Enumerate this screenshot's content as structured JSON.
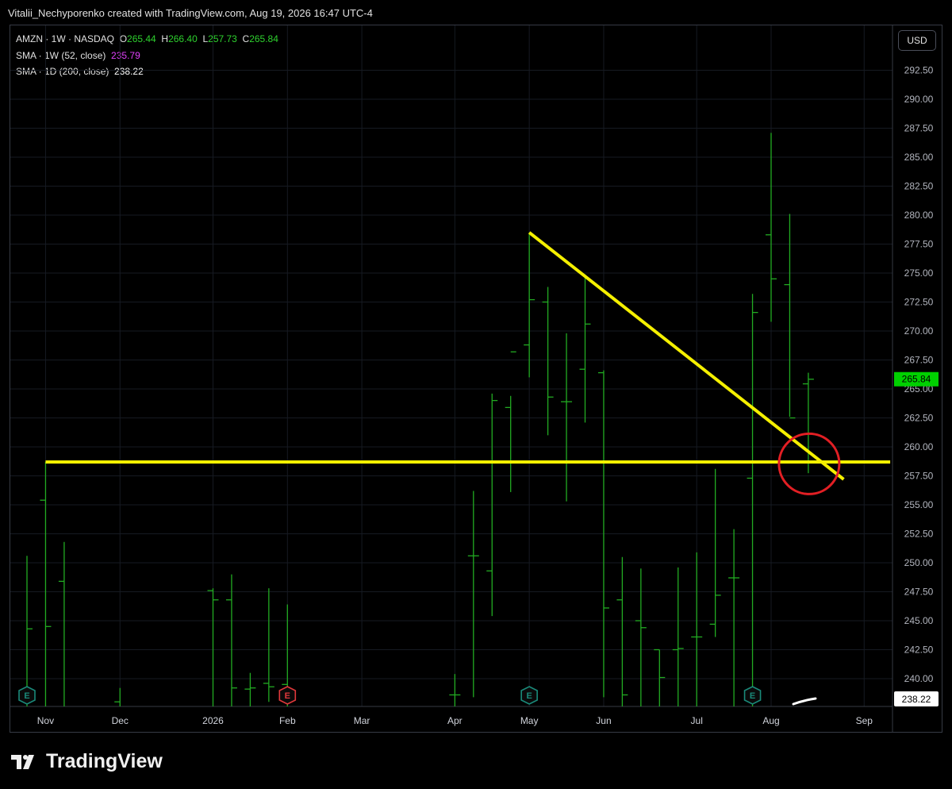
{
  "header": {
    "attribution": "Vitalii_Nechyporenko created with TradingView.com, Aug 19, 2026 16:47 UTC-4"
  },
  "legend": {
    "symbol": "AMZN · 1W · NASDAQ",
    "open_label": "O",
    "open": "265.44",
    "high_label": "H",
    "high": "266.40",
    "low_label": "L",
    "low": "257.73",
    "close_label": "C",
    "close": "265.84",
    "sma1_label": "SMA · 1W (52, close)",
    "sma1_value": "235.79",
    "sma2_label": "SMA · 1D (200, close)",
    "sma2_value": "238.22"
  },
  "currency_button": "USD",
  "brand": "TradingView",
  "colors": {
    "bar": "#22ab22",
    "drawing": "#f5f000",
    "circle": "#e21f24",
    "last_price_bg": "#00d000",
    "sma1": "#e040fb",
    "earnings_green": "#1a8a7a",
    "earnings_red": "#e0383b"
  },
  "chart_data": {
    "type": "ohlc",
    "interval": "1W",
    "ylim": [
      238.5,
      294
    ],
    "y_ticks": [
      "240.00",
      "242.50",
      "245.00",
      "247.50",
      "250.00",
      "252.50",
      "255.00",
      "257.50",
      "260.00",
      "262.50",
      "265.00",
      "267.50",
      "270.00",
      "272.50",
      "275.00",
      "277.50",
      "280.00",
      "282.50",
      "285.00",
      "287.50",
      "290.00",
      "292.50"
    ],
    "x_labels": [
      {
        "label": "Nov",
        "i": 1
      },
      {
        "label": "Dec",
        "i": 5
      },
      {
        "label": "2026",
        "i": 10
      },
      {
        "label": "Feb",
        "i": 14
      },
      {
        "label": "Mar",
        "i": 18
      },
      {
        "label": "Apr",
        "i": 23
      },
      {
        "label": "May",
        "i": 27
      },
      {
        "label": "Jun",
        "i": 31
      },
      {
        "label": "Jul",
        "i": 36
      },
      {
        "label": "Aug",
        "i": 40
      },
      {
        "label": "Sep",
        "i": 45
      }
    ],
    "bars": [
      {
        "i": 0,
        "o": 238.1,
        "h": 250.6,
        "l": 237.0,
        "c": 244.3
      },
      {
        "i": 1,
        "o": 255.4,
        "h": 258.7,
        "l": 236.0,
        "c": 244.5
      },
      {
        "i": 2,
        "o": 248.4,
        "h": 251.8,
        "l": 237.0,
        "c": 237.0
      },
      {
        "i": 5,
        "o": 238.0,
        "h": 239.2,
        "l": 237.0,
        "c": 237.5
      },
      {
        "i": 10,
        "o": 247.6,
        "h": 247.8,
        "l": 237.0,
        "c": 246.8
      },
      {
        "i": 11,
        "o": 246.8,
        "h": 249.0,
        "l": 237.0,
        "c": 239.2
      },
      {
        "i": 12,
        "o": 239.1,
        "h": 240.5,
        "l": 237.0,
        "c": 239.2
      },
      {
        "i": 13,
        "o": 239.6,
        "h": 247.8,
        "l": 238.0,
        "c": 239.3
      },
      {
        "i": 14,
        "o": 239.5,
        "h": 246.4,
        "l": 237.0,
        "c": 238.9
      },
      {
        "i": 23,
        "o": 238.6,
        "h": 240.4,
        "l": 237.0,
        "c": 238.6
      },
      {
        "i": 24,
        "o": 250.6,
        "h": 256.2,
        "l": 238.4,
        "c": 250.6
      },
      {
        "i": 25,
        "o": 249.3,
        "h": 264.6,
        "l": 245.4,
        "c": 264.0
      },
      {
        "i": 26,
        "o": 263.4,
        "h": 264.4,
        "l": 256.1,
        "c": 268.2
      },
      {
        "i": 27,
        "o": 268.8,
        "h": 278.5,
        "l": 266.0,
        "c": 272.7
      },
      {
        "i": 28,
        "o": 272.5,
        "h": 273.8,
        "l": 261.0,
        "c": 264.3
      },
      {
        "i": 29,
        "o": 263.9,
        "h": 269.8,
        "l": 255.3,
        "c": 263.9
      },
      {
        "i": 30,
        "o": 266.7,
        "h": 274.9,
        "l": 262.1,
        "c": 270.6
      },
      {
        "i": 31,
        "o": 266.4,
        "h": 266.6,
        "l": 238.4,
        "c": 246.1
      },
      {
        "i": 32,
        "o": 246.8,
        "h": 250.5,
        "l": 237.0,
        "c": 238.6
      },
      {
        "i": 33,
        "o": 245.0,
        "h": 249.5,
        "l": 237.0,
        "c": 244.4
      },
      {
        "i": 34,
        "o": 242.5,
        "h": 242.5,
        "l": 237.0,
        "c": 240.1
      },
      {
        "i": 35,
        "o": 242.5,
        "h": 249.6,
        "l": 237.0,
        "c": 242.6
      },
      {
        "i": 36,
        "o": 243.6,
        "h": 250.9,
        "l": 237.0,
        "c": 243.6
      },
      {
        "i": 37,
        "o": 244.7,
        "h": 258.1,
        "l": 243.6,
        "c": 247.2
      },
      {
        "i": 38,
        "o": 248.7,
        "h": 252.9,
        "l": 237.0,
        "c": 248.7
      },
      {
        "i": 39,
        "o": 257.3,
        "h": 273.2,
        "l": 237.0,
        "c": 271.6
      },
      {
        "i": 40,
        "o": 278.3,
        "h": 287.1,
        "l": 270.8,
        "c": 274.5
      },
      {
        "i": 41,
        "o": 274.0,
        "h": 280.1,
        "l": 262.6,
        "c": 262.5
      },
      {
        "i": 42,
        "o": 265.44,
        "h": 266.4,
        "l": 257.73,
        "c": 265.84
      }
    ],
    "earnings_markers": [
      {
        "i": 0,
        "color": "green",
        "label": "E"
      },
      {
        "i": 14,
        "color": "red",
        "label": "E"
      },
      {
        "i": 27,
        "color": "green",
        "label": "E"
      },
      {
        "i": 39,
        "color": "green",
        "label": "E"
      }
    ],
    "drawings": {
      "horizontal_line": {
        "price": 258.7,
        "from_i": 1,
        "to_i": 46.4
      },
      "trend_line": {
        "from": {
          "i": 27,
          "price": 278.5
        },
        "to": {
          "i": 43.9,
          "price": 257.2
        }
      },
      "circle": {
        "i": 42,
        "price": 258.5
      }
    },
    "last_price_label": "265.84",
    "sma_label": "238.22"
  }
}
